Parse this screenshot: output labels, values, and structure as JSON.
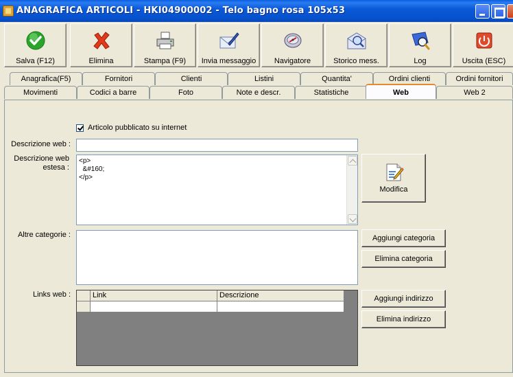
{
  "window": {
    "title": "ANAGRAFICA ARTICOLI - HKI04900002 - Telo bagno rosa 105x53"
  },
  "toolbar": {
    "buttons": [
      {
        "label": "Salva (F12)",
        "icon": "check-icon"
      },
      {
        "label": "Elimina",
        "icon": "delete-x-icon"
      },
      {
        "label": "Stampa (F9)",
        "icon": "printer-icon"
      },
      {
        "label": "Invia messaggio",
        "icon": "message-pen-icon"
      },
      {
        "label": "Navigatore",
        "icon": "navigator-icon"
      },
      {
        "label": "Storico mess.",
        "icon": "message-history-icon"
      },
      {
        "label": "Log",
        "icon": "log-magnifier-icon"
      },
      {
        "label": "Uscita (ESC)",
        "icon": "exit-power-icon"
      }
    ]
  },
  "tabs": {
    "row1": [
      "Anagrafica(F5)",
      "Fornitori",
      "Clienti",
      "Listini",
      "Quantita'",
      "Ordini clienti",
      "Ordini fornitori"
    ],
    "row2": [
      "Movimenti",
      "Codici a barre",
      "Foto",
      "Note e descr.",
      "Statistiche",
      "Web",
      "Web 2"
    ],
    "active": "Web"
  },
  "web": {
    "published_checkbox_label": "Articolo pubblicato su internet",
    "published": true,
    "descrizione_web_label": "Descrizione web :",
    "descrizione_web_value": "",
    "descrizione_estesa_label_1": "Descrizione web",
    "descrizione_estesa_label_2": "estesa :",
    "descrizione_estesa_value": "<p>\n  &#160;\n</p>",
    "modifica_label": "Modifica",
    "altre_categorie_label": "Altre categorie :",
    "aggiungi_categoria_label": "Aggiungi categoria",
    "elimina_categoria_label": "Elimina categoria",
    "links_web_label": "Links web :",
    "links_columns": [
      "Link",
      "Descrizione"
    ],
    "aggiungi_indirizzo_label": "Aggiungi indirizzo",
    "elimina_indirizzo_label": "Elimina indirizzo"
  }
}
